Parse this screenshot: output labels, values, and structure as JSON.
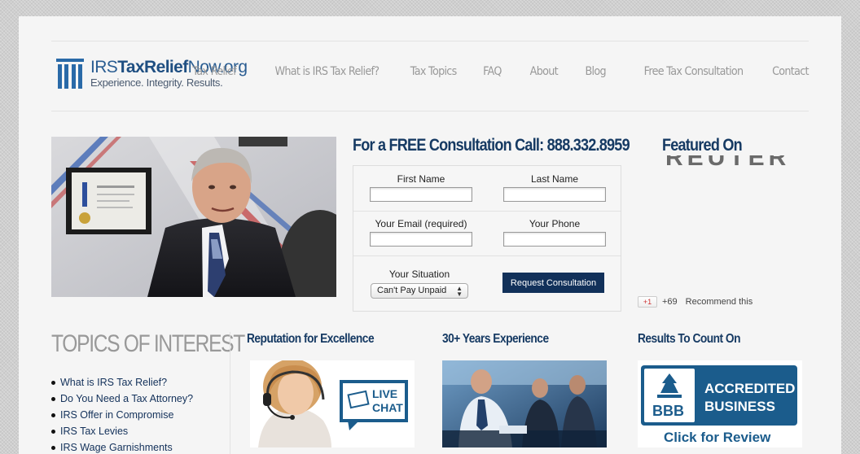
{
  "site": {
    "logo_title_prefix": "IRS",
    "logo_title_bold": "TaxRelief",
    "logo_title_suffix": "Now.org",
    "tagline": "Experience. Integrity. Results."
  },
  "nav": {
    "items": [
      "Tax Relief",
      "What is IRS Tax Relief?",
      "Tax Topics",
      "FAQ",
      "About",
      "Blog",
      "Free Tax Consultation",
      "Contact"
    ]
  },
  "consultation": {
    "title": "For a FREE Consultation Call: 888.332.8959",
    "first_name_label": "First Name",
    "last_name_label": "Last Name",
    "email_label": "Your Email (required)",
    "phone_label": "Your Phone",
    "situation_label": "Your Situation",
    "situation_value": "Can't Pay Unpaid",
    "submit_label": "Request Consultation"
  },
  "featured": {
    "title": "Featured On",
    "logo_text": "REUTERS"
  },
  "social": {
    "gplus_label": "+1",
    "count": "+69",
    "recommend": "Recommend this"
  },
  "topics": {
    "title": "TOPICS OF INTEREST",
    "items": [
      "What is IRS Tax Relief?",
      "Do You Need a Tax Attorney?",
      "IRS Offer in Compromise",
      "IRS Tax Levies",
      "IRS Wage Garnishments"
    ]
  },
  "columns": {
    "reputation_title": "Reputation for Excellence",
    "live_chat_line1": "LIVE",
    "live_chat_line2": "CHAT",
    "experience_title": "30+ Years Experience",
    "results_title": "Results To Count On",
    "bbb_line1": "ACCREDITED",
    "bbb_line2": "BUSINESS",
    "bbb_logo": "BBB",
    "bbb_cta": "Click for Review"
  },
  "colors": {
    "brand_navy": "#163a63",
    "button_navy": "#12315a",
    "nav_gray": "#999999",
    "bbb_blue": "#1b5c8c"
  }
}
